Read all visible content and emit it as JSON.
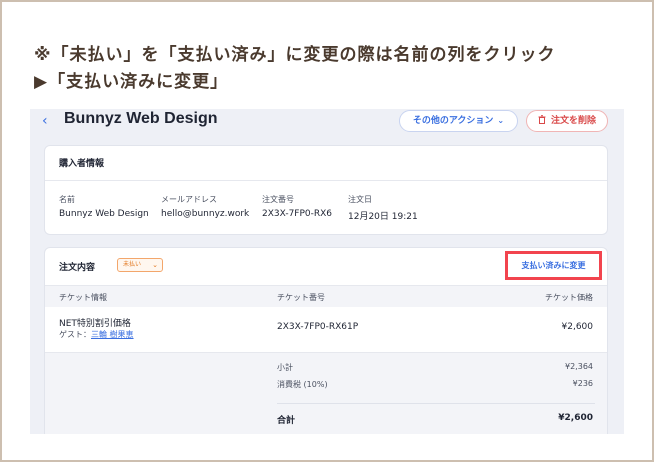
{
  "instruction": {
    "line1": "※「未払い」を「支払い済み」に変更の際は名前の列をクリック",
    "line2": "▶「支払い済みに変更」"
  },
  "header": {
    "back_icon": "‹",
    "title": "Bunnyz Web Design",
    "more_actions_label": "その他のアクション",
    "delete_label": "注文を削除"
  },
  "buyer": {
    "section_title": "購入者情報",
    "fields": [
      {
        "label": "名前",
        "value": "Bunnyz Web Design"
      },
      {
        "label": "メールアドレス",
        "value": "hello@bunnyz.work"
      },
      {
        "label": "注文番号",
        "value": "2X3X-7FP0-RX6"
      },
      {
        "label": "注文日",
        "value": "12月20日 19:21"
      }
    ]
  },
  "order": {
    "section_title": "注文内容",
    "status_badge": "未払い",
    "mark_paid_label": "支払い済みに変更",
    "columns": [
      "チケット情報",
      "チケット番号",
      "チケット価格"
    ],
    "row": {
      "ticket_name": "NET特別割引価格",
      "guest_prefix": "ゲスト：",
      "guest_name": "三輪 樹果恵",
      "ticket_number": "2X3X-7FP0-RX61P",
      "price": "¥2,600"
    },
    "summary": {
      "subtotal_label": "小計",
      "subtotal_value": "¥2,364",
      "tax_label": "消費税 (10%)",
      "tax_value": "¥236",
      "total_label": "合計",
      "total_value": "¥2,600"
    }
  },
  "colors": {
    "accent": "#3a6fe0",
    "danger": "#d94848",
    "highlight_box": "#f2444e",
    "badge": "#e2771f",
    "instruction_text": "#4a3a2e",
    "frame_border": "#cdbfb0"
  },
  "icons": {
    "back": "chevron-left-icon",
    "more_actions": "chevron-down-icon",
    "delete": "trash-icon",
    "status": "chevron-down-icon"
  }
}
